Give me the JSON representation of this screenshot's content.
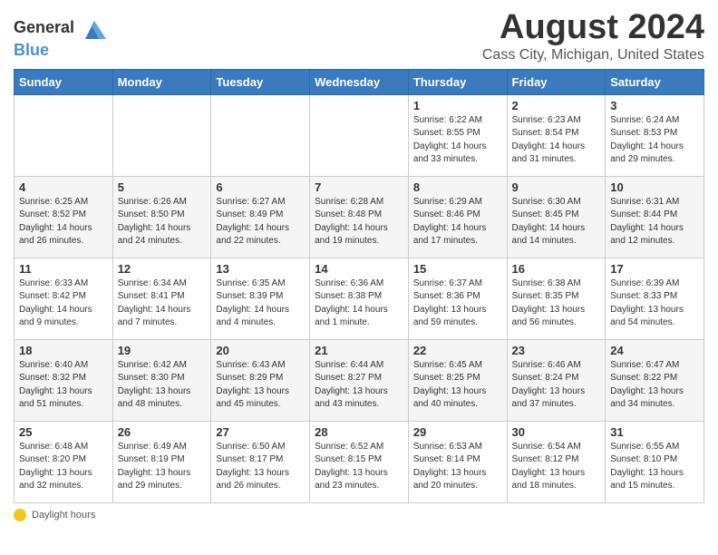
{
  "logo": {
    "general": "General",
    "blue": "Blue"
  },
  "title": "August 2024",
  "subtitle": "Cass City, Michigan, United States",
  "weekdays": [
    "Sunday",
    "Monday",
    "Tuesday",
    "Wednesday",
    "Thursday",
    "Friday",
    "Saturday"
  ],
  "footer": {
    "label": "Daylight hours"
  },
  "weeks": [
    [
      {
        "day": "",
        "info": ""
      },
      {
        "day": "",
        "info": ""
      },
      {
        "day": "",
        "info": ""
      },
      {
        "day": "",
        "info": ""
      },
      {
        "day": "1",
        "info": "Sunrise: 6:22 AM\nSunset: 8:55 PM\nDaylight: 14 hours\nand 33 minutes."
      },
      {
        "day": "2",
        "info": "Sunrise: 6:23 AM\nSunset: 8:54 PM\nDaylight: 14 hours\nand 31 minutes."
      },
      {
        "day": "3",
        "info": "Sunrise: 6:24 AM\nSunset: 8:53 PM\nDaylight: 14 hours\nand 29 minutes."
      }
    ],
    [
      {
        "day": "4",
        "info": "Sunrise: 6:25 AM\nSunset: 8:52 PM\nDaylight: 14 hours\nand 26 minutes."
      },
      {
        "day": "5",
        "info": "Sunrise: 6:26 AM\nSunset: 8:50 PM\nDaylight: 14 hours\nand 24 minutes."
      },
      {
        "day": "6",
        "info": "Sunrise: 6:27 AM\nSunset: 8:49 PM\nDaylight: 14 hours\nand 22 minutes."
      },
      {
        "day": "7",
        "info": "Sunrise: 6:28 AM\nSunset: 8:48 PM\nDaylight: 14 hours\nand 19 minutes."
      },
      {
        "day": "8",
        "info": "Sunrise: 6:29 AM\nSunset: 8:46 PM\nDaylight: 14 hours\nand 17 minutes."
      },
      {
        "day": "9",
        "info": "Sunrise: 6:30 AM\nSunset: 8:45 PM\nDaylight: 14 hours\nand 14 minutes."
      },
      {
        "day": "10",
        "info": "Sunrise: 6:31 AM\nSunset: 8:44 PM\nDaylight: 14 hours\nand 12 minutes."
      }
    ],
    [
      {
        "day": "11",
        "info": "Sunrise: 6:33 AM\nSunset: 8:42 PM\nDaylight: 14 hours\nand 9 minutes."
      },
      {
        "day": "12",
        "info": "Sunrise: 6:34 AM\nSunset: 8:41 PM\nDaylight: 14 hours\nand 7 minutes."
      },
      {
        "day": "13",
        "info": "Sunrise: 6:35 AM\nSunset: 8:39 PM\nDaylight: 14 hours\nand 4 minutes."
      },
      {
        "day": "14",
        "info": "Sunrise: 6:36 AM\nSunset: 8:38 PM\nDaylight: 14 hours\nand 1 minute."
      },
      {
        "day": "15",
        "info": "Sunrise: 6:37 AM\nSunset: 8:36 PM\nDaylight: 13 hours\nand 59 minutes."
      },
      {
        "day": "16",
        "info": "Sunrise: 6:38 AM\nSunset: 8:35 PM\nDaylight: 13 hours\nand 56 minutes."
      },
      {
        "day": "17",
        "info": "Sunrise: 6:39 AM\nSunset: 8:33 PM\nDaylight: 13 hours\nand 54 minutes."
      }
    ],
    [
      {
        "day": "18",
        "info": "Sunrise: 6:40 AM\nSunset: 8:32 PM\nDaylight: 13 hours\nand 51 minutes."
      },
      {
        "day": "19",
        "info": "Sunrise: 6:42 AM\nSunset: 8:30 PM\nDaylight: 13 hours\nand 48 minutes."
      },
      {
        "day": "20",
        "info": "Sunrise: 6:43 AM\nSunset: 8:29 PM\nDaylight: 13 hours\nand 45 minutes."
      },
      {
        "day": "21",
        "info": "Sunrise: 6:44 AM\nSunset: 8:27 PM\nDaylight: 13 hours\nand 43 minutes."
      },
      {
        "day": "22",
        "info": "Sunrise: 6:45 AM\nSunset: 8:25 PM\nDaylight: 13 hours\nand 40 minutes."
      },
      {
        "day": "23",
        "info": "Sunrise: 6:46 AM\nSunset: 8:24 PM\nDaylight: 13 hours\nand 37 minutes."
      },
      {
        "day": "24",
        "info": "Sunrise: 6:47 AM\nSunset: 8:22 PM\nDaylight: 13 hours\nand 34 minutes."
      }
    ],
    [
      {
        "day": "25",
        "info": "Sunrise: 6:48 AM\nSunset: 8:20 PM\nDaylight: 13 hours\nand 32 minutes."
      },
      {
        "day": "26",
        "info": "Sunrise: 6:49 AM\nSunset: 8:19 PM\nDaylight: 13 hours\nand 29 minutes."
      },
      {
        "day": "27",
        "info": "Sunrise: 6:50 AM\nSunset: 8:17 PM\nDaylight: 13 hours\nand 26 minutes."
      },
      {
        "day": "28",
        "info": "Sunrise: 6:52 AM\nSunset: 8:15 PM\nDaylight: 13 hours\nand 23 minutes."
      },
      {
        "day": "29",
        "info": "Sunrise: 6:53 AM\nSunset: 8:14 PM\nDaylight: 13 hours\nand 20 minutes."
      },
      {
        "day": "30",
        "info": "Sunrise: 6:54 AM\nSunset: 8:12 PM\nDaylight: 13 hours\nand 18 minutes."
      },
      {
        "day": "31",
        "info": "Sunrise: 6:55 AM\nSunset: 8:10 PM\nDaylight: 13 hours\nand 15 minutes."
      }
    ]
  ]
}
